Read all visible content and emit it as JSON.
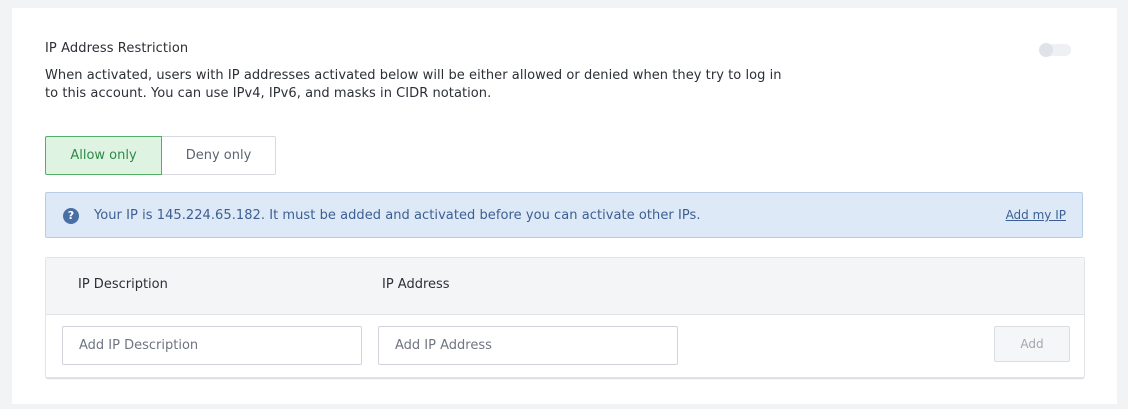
{
  "section": {
    "title": "IP Address Restriction",
    "description": "When activated, users with IP addresses activated below will be either allowed or denied when they try to log in to this account. You can use IPv4, IPv6, and masks in CIDR notation.",
    "toggle_on": false
  },
  "mode": {
    "options": [
      "Allow only",
      "Deny only"
    ],
    "selected": "Allow only"
  },
  "info": {
    "icon": "question-icon",
    "icon_glyph": "?",
    "message": "Your IP is 145.224.65.182. It must be added and activated before you can activate other IPs.",
    "link_label": "Add my IP"
  },
  "table": {
    "columns": [
      "IP Description",
      "IP Address"
    ],
    "description_placeholder": "Add IP Description",
    "address_placeholder": "Add IP Address",
    "add_label": "Add"
  },
  "colors": {
    "accent_green": "#2e8b46",
    "info_bg": "#dde9f6",
    "info_text": "#3c5f93"
  }
}
